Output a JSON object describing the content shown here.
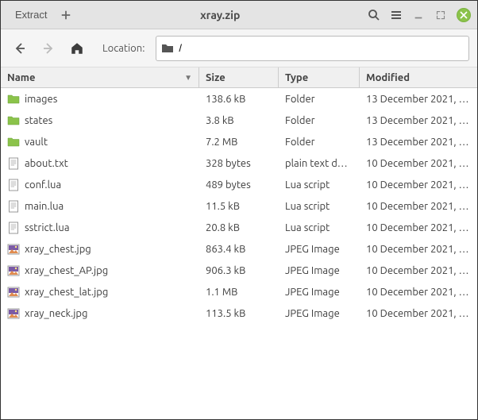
{
  "titlebar": {
    "extract_label": "Extract",
    "title": "xray.zip"
  },
  "toolbar": {
    "location_label": "Location:",
    "path": "/"
  },
  "columns": {
    "name": "Name",
    "size": "Size",
    "type": "Type",
    "modified": "Modified"
  },
  "rows": [
    {
      "icon": "folder",
      "name": "images",
      "size": "138.6 kB",
      "type": "Folder",
      "modified": "13 December 2021, …"
    },
    {
      "icon": "folder",
      "name": "states",
      "size": "3.8 kB",
      "type": "Folder",
      "modified": "13 December 2021, …"
    },
    {
      "icon": "folder",
      "name": "vault",
      "size": "7.2 MB",
      "type": "Folder",
      "modified": "13 December 2021, …"
    },
    {
      "icon": "text",
      "name": "about.txt",
      "size": "328 bytes",
      "type": "plain text do…",
      "modified": "10 December 2021, …"
    },
    {
      "icon": "text",
      "name": "conf.lua",
      "size": "489 bytes",
      "type": "Lua script",
      "modified": "10 December 2021, …"
    },
    {
      "icon": "text",
      "name": "main.lua",
      "size": "11.5 kB",
      "type": "Lua script",
      "modified": "10 December 2021, …"
    },
    {
      "icon": "text",
      "name": "sstrict.lua",
      "size": "20.8 kB",
      "type": "Lua script",
      "modified": "10 December 2021, …"
    },
    {
      "icon": "image",
      "name": "xray_chest.jpg",
      "size": "863.4 kB",
      "type": "JPEG Image",
      "modified": "10 December 2021, …"
    },
    {
      "icon": "image",
      "name": "xray_chest_AP.jpg",
      "size": "906.3 kB",
      "type": "JPEG Image",
      "modified": "10 December 2021, …"
    },
    {
      "icon": "image",
      "name": "xray_chest_lat.jpg",
      "size": "1.1 MB",
      "type": "JPEG Image",
      "modified": "10 December 2021, …"
    },
    {
      "icon": "image",
      "name": "xray_neck.jpg",
      "size": "113.5 kB",
      "type": "JPEG Image",
      "modified": "10 December 2021, …"
    }
  ]
}
